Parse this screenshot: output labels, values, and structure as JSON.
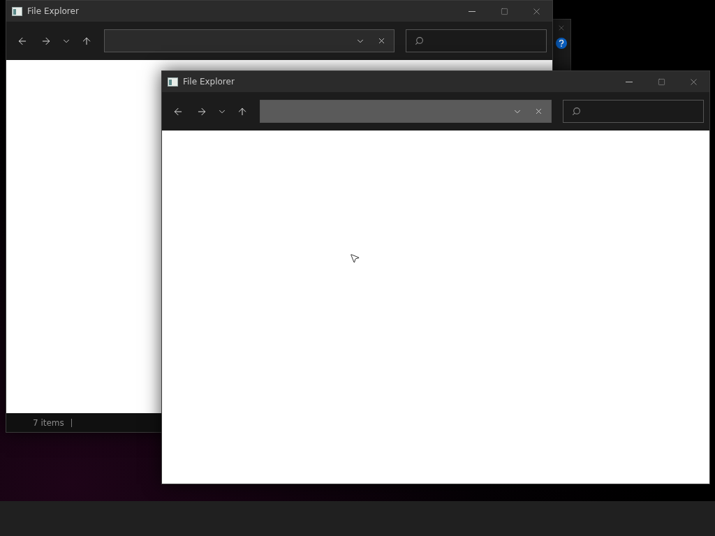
{
  "windows": [
    {
      "title": "File Explorer",
      "active": false,
      "status": "7 items"
    },
    {
      "title": "File Explorer",
      "active": true
    }
  ]
}
